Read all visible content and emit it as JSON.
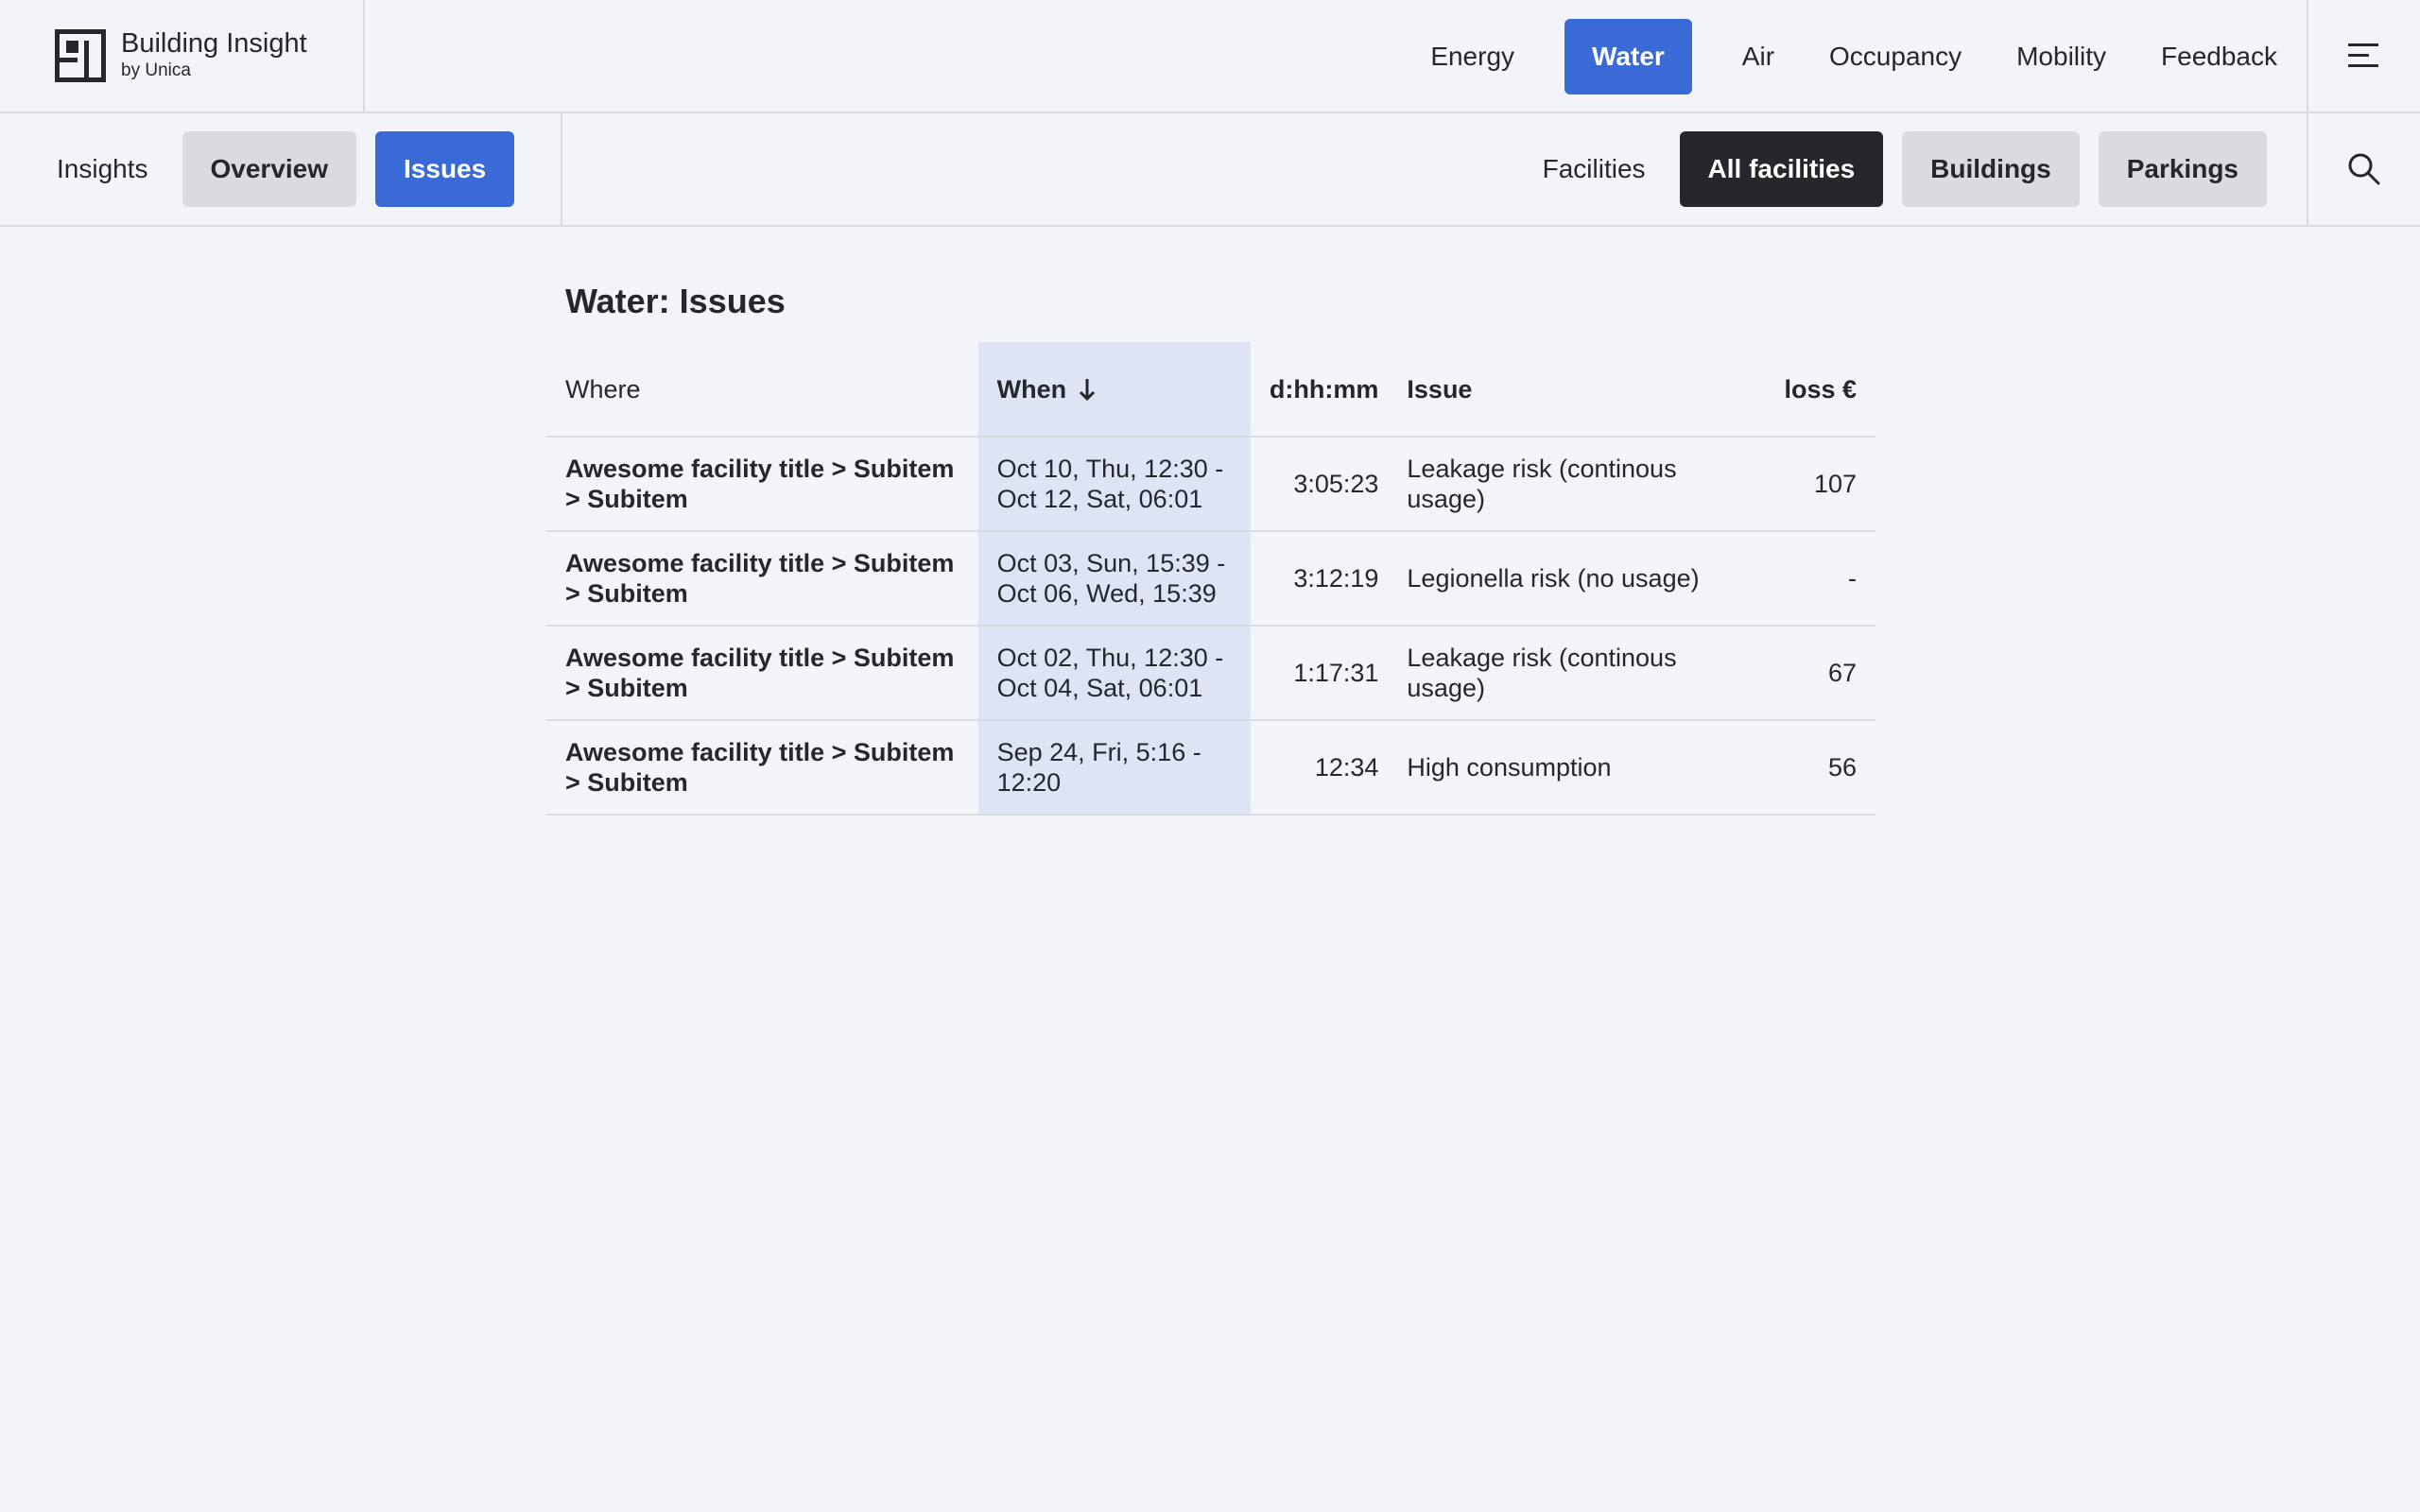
{
  "brand": {
    "title": "Building Insight",
    "subtitle": "by Unica"
  },
  "main_nav": [
    {
      "label": "Energy",
      "active": false
    },
    {
      "label": "Water",
      "active": true
    },
    {
      "label": "Air",
      "active": false
    },
    {
      "label": "Occupancy",
      "active": false
    },
    {
      "label": "Mobility",
      "active": false
    },
    {
      "label": "Feedback",
      "active": false
    }
  ],
  "insights": {
    "label": "Insights",
    "tabs": [
      {
        "label": "Overview",
        "active": false
      },
      {
        "label": "Issues",
        "active": true
      }
    ]
  },
  "facilities": {
    "label": "Facilities",
    "filters": [
      {
        "label": "All facilities",
        "active": true
      },
      {
        "label": "Buildings",
        "active": false
      },
      {
        "label": "Parkings",
        "active": false
      }
    ]
  },
  "page_title": "Water: Issues",
  "table": {
    "columns": {
      "where": "Where",
      "when": "When",
      "duration": "d:hh:mm",
      "issue": "Issue",
      "loss": "loss €"
    },
    "sort": {
      "column": "when",
      "direction": "desc"
    },
    "rows": [
      {
        "where": "Awesome facility title > Subitem > Subitem",
        "when": "Oct 10, Thu, 12:30 - Oct 12, Sat, 06:01",
        "duration": "3:05:23",
        "issue": "Leakage risk (continous usage)",
        "loss": "107"
      },
      {
        "where": "Awesome facility title > Subitem > Subitem",
        "when": "Oct 03, Sun, 15:39 - Oct 06, Wed, 15:39",
        "duration": "3:12:19",
        "issue": "Legionella risk (no usage)",
        "loss": "-"
      },
      {
        "where": "Awesome facility title > Subitem > Subitem",
        "when": "Oct 02, Thu, 12:30 - Oct 04, Sat, 06:01",
        "duration": "1:17:31",
        "issue": "Leakage risk (continous usage)",
        "loss": "67"
      },
      {
        "where": "Awesome facility title > Subitem > Subitem",
        "when": "Sep 24, Fri, 5:16 - 12:20",
        "duration": "12:34",
        "issue": "High consumption",
        "loss": "56"
      }
    ]
  },
  "colors": {
    "accent": "#3a6ad6",
    "dark": "#25272c",
    "background": "#f2f4f9",
    "sorted_column": "#dde4f4",
    "pill_gray": "#d9dbe0"
  },
  "icons": {
    "logo": "building-logo-icon",
    "menu": "menu-icon",
    "search": "search-icon",
    "sort": "arrow-down-icon"
  }
}
